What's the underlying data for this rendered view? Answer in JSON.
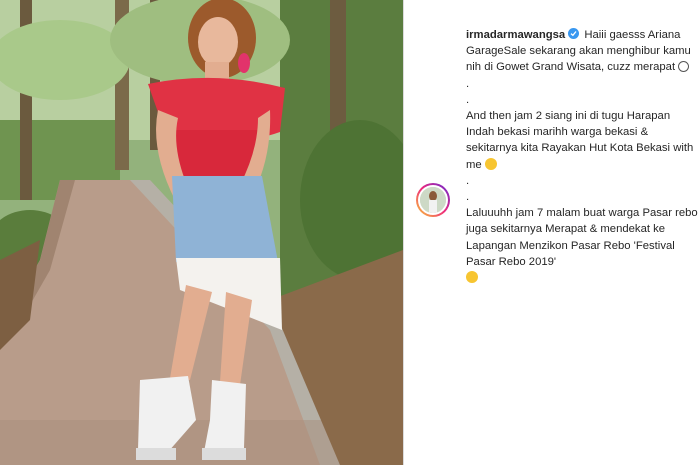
{
  "photo": {
    "description_icon": "photo-woman-red-top"
  },
  "post": {
    "username": "irmadarmawangsa",
    "verified_icon": "verified-badge-icon",
    "caption_line1": "Haiii gaesss Ariana GarageSale sekarang akan menghibur kamu nih di Gowet Grand Wisata, cuzz merapat",
    "dot1": ".",
    "dot2": ".",
    "caption_line2": "And then jam 2 siang ini di tugu Harapan Indah bekasi marihh warga bekasi & sekitarnya kita Rayakan Hut Kota Bekasi with me",
    "dot3": ".",
    "dot4": ".",
    "caption_line3": "Laluuuhh jam 7 malam buat warga Pasar rebo juga sekitarnya Merapat & mendekat ke Lapangan Menzikon Pasar Rebo 'Festival Pasar Rebo 2019'"
  },
  "colors": {
    "verified": "#3897f0",
    "text": "#262626",
    "divider": "#dbdbdb"
  }
}
